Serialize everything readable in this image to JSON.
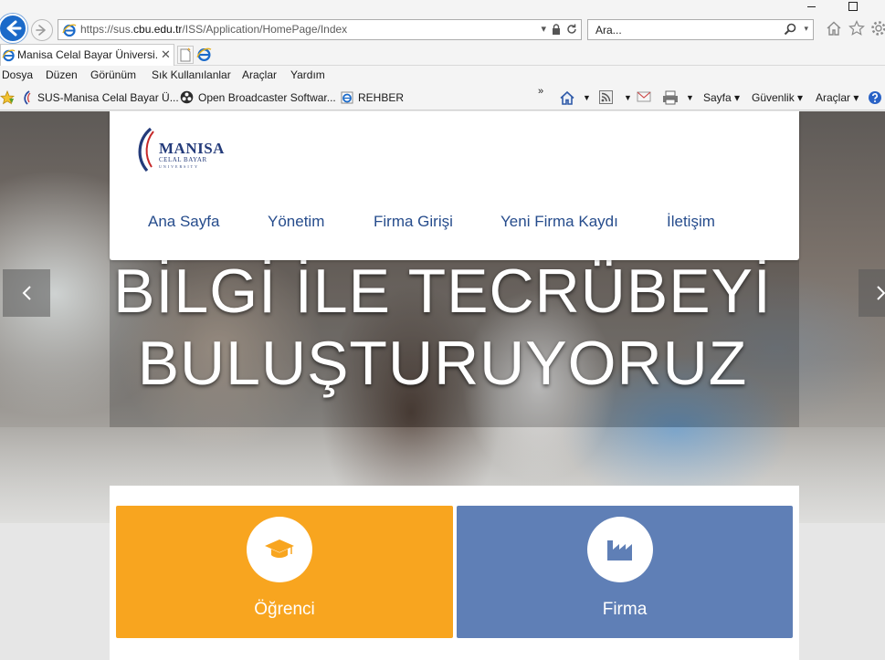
{
  "browser": {
    "url_prefix": "https://sus.",
    "url_domain": "cbu.edu.tr",
    "url_path": "/ISS/Application/HomePage/Index",
    "search_placeholder": "Ara...",
    "tab_title": "Manisa Celal Bayar Üniversi...",
    "tab_close": "✕",
    "menu": [
      "Dosya",
      "Düzen",
      "Görünüm",
      "Sık Kullanılanlar",
      "Araçlar",
      "Yardım"
    ],
    "favorites": [
      "SUS-Manisa Celal Bayar Ü...",
      "Open Broadcaster Softwar...",
      "REHBER"
    ],
    "chevron": "»",
    "commands": [
      "Sayfa ▾",
      "Güvenlik ▾",
      "Araçlar ▾"
    ]
  },
  "site": {
    "logo_name": "MANISA",
    "logo_sub": "CELAL BAYAR",
    "logo_uni": "UNIVERSITY",
    "nav": [
      "Ana Sayfa",
      "Yönetim",
      "Firma Girişi",
      "Yeni Firma Kaydı",
      "İletişim"
    ],
    "hero_line_1": "BİLGİ İLE TECRÜBEYİ",
    "hero_line_2": "BULUŞTURUYORUZ",
    "tiles": [
      {
        "label": "Öğrenci",
        "icon": "graduation-cap-icon",
        "color": "#f8a51f"
      },
      {
        "label": "Firma",
        "icon": "factory-icon",
        "color": "#5f7fb6"
      }
    ]
  },
  "colors": {
    "ie_blue": "#1b6ac9",
    "nav_text": "#264c8c",
    "tile_orange": "#f8a51f",
    "tile_blue": "#5f7fb6"
  }
}
